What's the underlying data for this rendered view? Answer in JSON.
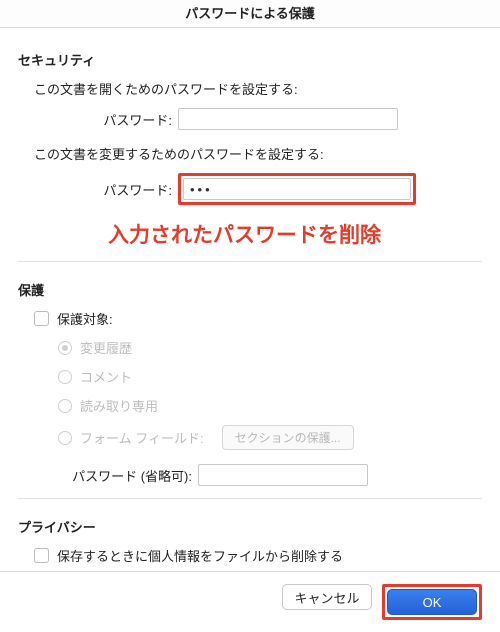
{
  "title": "パスワードによる保護",
  "section_security": "セキュリティ",
  "open_doc_label": "この文書を開くためのパスワードを設定する:",
  "password_label": "パスワード:",
  "modify_doc_label": "この文書を変更するためのパスワードを設定する:",
  "modify_password_value": "•••",
  "annotation_text": "入力されたパスワードを削除",
  "section_protection": "保護",
  "protect_target_label": "保護対象:",
  "radio_changes": "変更履歴",
  "radio_comments": "コメント",
  "radio_readonly": "読み取り専用",
  "radio_forms": "フォーム フィールド:",
  "protect_sections_btn": "セクションの保護...",
  "password_optional_label": "パスワード (省略可):",
  "section_privacy": "プライバシー",
  "privacy_checkbox_label": "保存するときに個人情報をファイルから削除する",
  "cancel_btn": "キャンセル",
  "ok_btn": "OK"
}
